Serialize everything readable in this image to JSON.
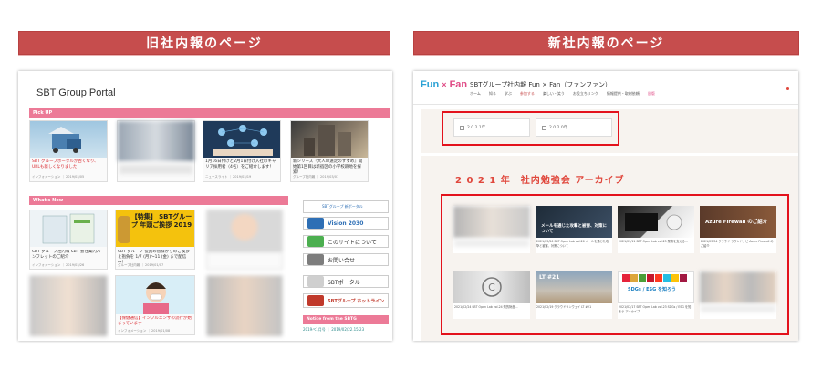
{
  "headers": {
    "old": "旧社内報のページ",
    "new": "新社内報のページ"
  },
  "old_portal": {
    "title": "SBT Group Portal",
    "pickup_label": "Pick UP",
    "whatsnew_label": "What's New",
    "pickup_cards": [
      {
        "caption": "SBT グループポータルが古くなり、URLも新しくなりました！",
        "meta": "インフォメーション ｜ 2019/03/05",
        "red": true
      },
      {
        "caption": "",
        "meta": "",
        "red": false
      },
      {
        "caption": "1月16日付けと2月1日付け入社のキャリア採用者（4名）をご紹介します！",
        "meta": "ニュースライト ｜ 2019/03/19",
        "red": false
      },
      {
        "caption": "新シリーズ『大人の遠足のすすめ』開始第1回目は新宿区の小学校跡地を探索！",
        "meta": "グループ社内報 ｜ 2019/03/01",
        "red": false
      }
    ],
    "news_cards": [
      {
        "img_title": "",
        "caption": "SBT グループ社内報 SBT 会社案内パンフレットのご紹介",
        "meta": "インフォメーション ｜ 2019/03/26",
        "red": false
      },
      {
        "img_title": "【特集】 SBTグループ 年頭ご挨拶 2019",
        "caption": "SBT グループ 役員の皆様からのご挨拶と抱負を 1/7 (月)〜11 (金) まで配信中！",
        "meta": "グループ社内報 ｜ 2019/01/07",
        "red": false
      },
      {
        "img_title": "",
        "caption": "",
        "meta": "",
        "red": false
      },
      {
        "img_title": "",
        "caption": "",
        "meta": "",
        "red": false
      },
      {
        "img_title": "",
        "caption": "【保健通信】インフルエンザの流行が始まっています",
        "meta": "インフォメーション ｜ 2019/01/08",
        "red": true
      },
      {
        "img_title": "",
        "caption": "",
        "meta": "",
        "red": false
      }
    ],
    "side_links": [
      {
        "label": "Vision 2030",
        "color": "#2e6fb5"
      },
      {
        "label": "このサイトについて",
        "color": "#4caf50"
      },
      {
        "label": "お問い合せ",
        "color": "#7d7d7d"
      },
      {
        "label": "SBTポータル",
        "color": "#555555"
      },
      {
        "label": "SBTグループ ホットライン",
        "color": "#c0392b"
      }
    ],
    "sbt_portal_banner": "SBTグループ 新ポータル",
    "notice_label": "Notice from the SBTG",
    "notice_text": "2019ペ1月号 ｜ 2019/02/22.15:23"
  },
  "new_portal": {
    "logo_fun": "Fun",
    "logo_x": "×",
    "logo_fan": "Fan",
    "site_title": "SBTグループ社内報 Fun × Fan（ファンファン）",
    "nav": [
      "ホーム",
      "知る",
      "学ぶ",
      "参加する",
      "楽しい・笑う",
      "お役立ちリンク",
      "情報提供・取材依頼",
      "旧版"
    ],
    "year_buttons": [
      "2 0 2 1年",
      "2 0 2 0年"
    ],
    "archive_title": "2 0 2 1 年　社内勉強会 アーカイブ",
    "tiles": [
      {
        "label": "",
        "text": ""
      },
      {
        "label": "メールを通じた攻撃と被害、対策について",
        "text": "2021/03/26 SBT Open Lab vol.26 メールを通じた攻撃と被害、対策について"
      },
      {
        "label": "",
        "text": "2021/03/11 SBT Open Lab vol.25 業務を支える…"
      },
      {
        "label": "Azure Firewall のご紹介",
        "text": "2021/03/04 クラウド ラウンドナビ Azure Firewall のご紹介"
      },
      {
        "label": "",
        "text": "2021/02/24 SBT Open Lab vol.24 知的財産…"
      },
      {
        "label": "LT #21",
        "text": "2021/02/19 クラウドランウェイ LT #21"
      },
      {
        "label": "SDGs / ESG を知ろう",
        "text": "2021/02/17 SBT Open Lab vol.23 SDGs / ESG を知ろう アーカイブ"
      },
      {
        "label": "",
        "text": ""
      }
    ]
  }
}
